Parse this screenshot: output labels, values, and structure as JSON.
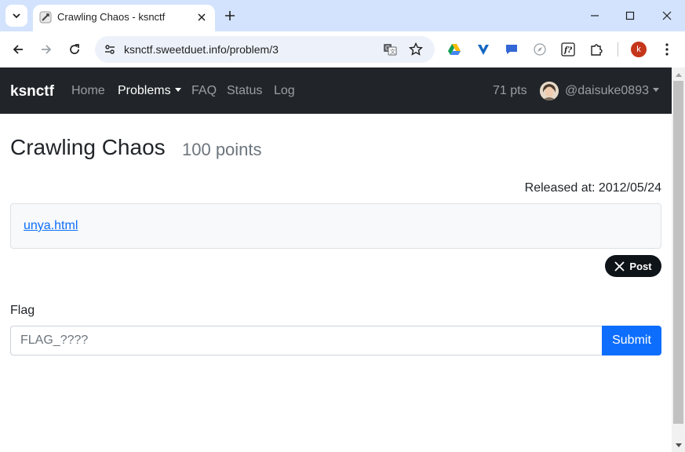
{
  "browser": {
    "tab_title": "Crawling Chaos - ksnctf",
    "url": "ksnctf.sweetduet.info/problem/3",
    "profile_initial": "k",
    "icons": {
      "tab_search": "chevron-down-icon",
      "close": "close-icon",
      "new_tab": "plus-icon",
      "back": "arrow-left-icon",
      "forward": "arrow-right-icon",
      "reload": "reload-icon",
      "site_info": "tune-icon",
      "translate": "translate-icon",
      "bookmark": "star-icon",
      "extensions": [
        "google-drive-icon",
        "vee-icon",
        "chat-bubble-icon",
        "compass-icon",
        "fx-icon",
        "puzzle-icon"
      ],
      "menu": "kebab-menu-icon"
    }
  },
  "navbar": {
    "brand": "ksnctf",
    "links": [
      {
        "label": "Home",
        "active": false
      },
      {
        "label": "Problems",
        "active": true,
        "dropdown": true
      },
      {
        "label": "FAQ",
        "active": false
      },
      {
        "label": "Status",
        "active": false
      },
      {
        "label": "Log",
        "active": false
      }
    ],
    "points": "71 pts",
    "username": "@daisuke0893"
  },
  "problem": {
    "title": "Crawling Chaos",
    "points": "100 points",
    "released": "Released at: 2012/05/24",
    "file_link": "unya.html",
    "share_label": "Post"
  },
  "flag_form": {
    "label": "Flag",
    "placeholder": "FLAG_????",
    "value": "",
    "submit_label": "Submit"
  },
  "colors": {
    "navbar_bg": "#212529",
    "primary": "#0d6efd",
    "tabstrip_bg": "#d3e3fd",
    "omnibox_bg": "#edf2fa",
    "profile_bg": "#c5361b"
  }
}
